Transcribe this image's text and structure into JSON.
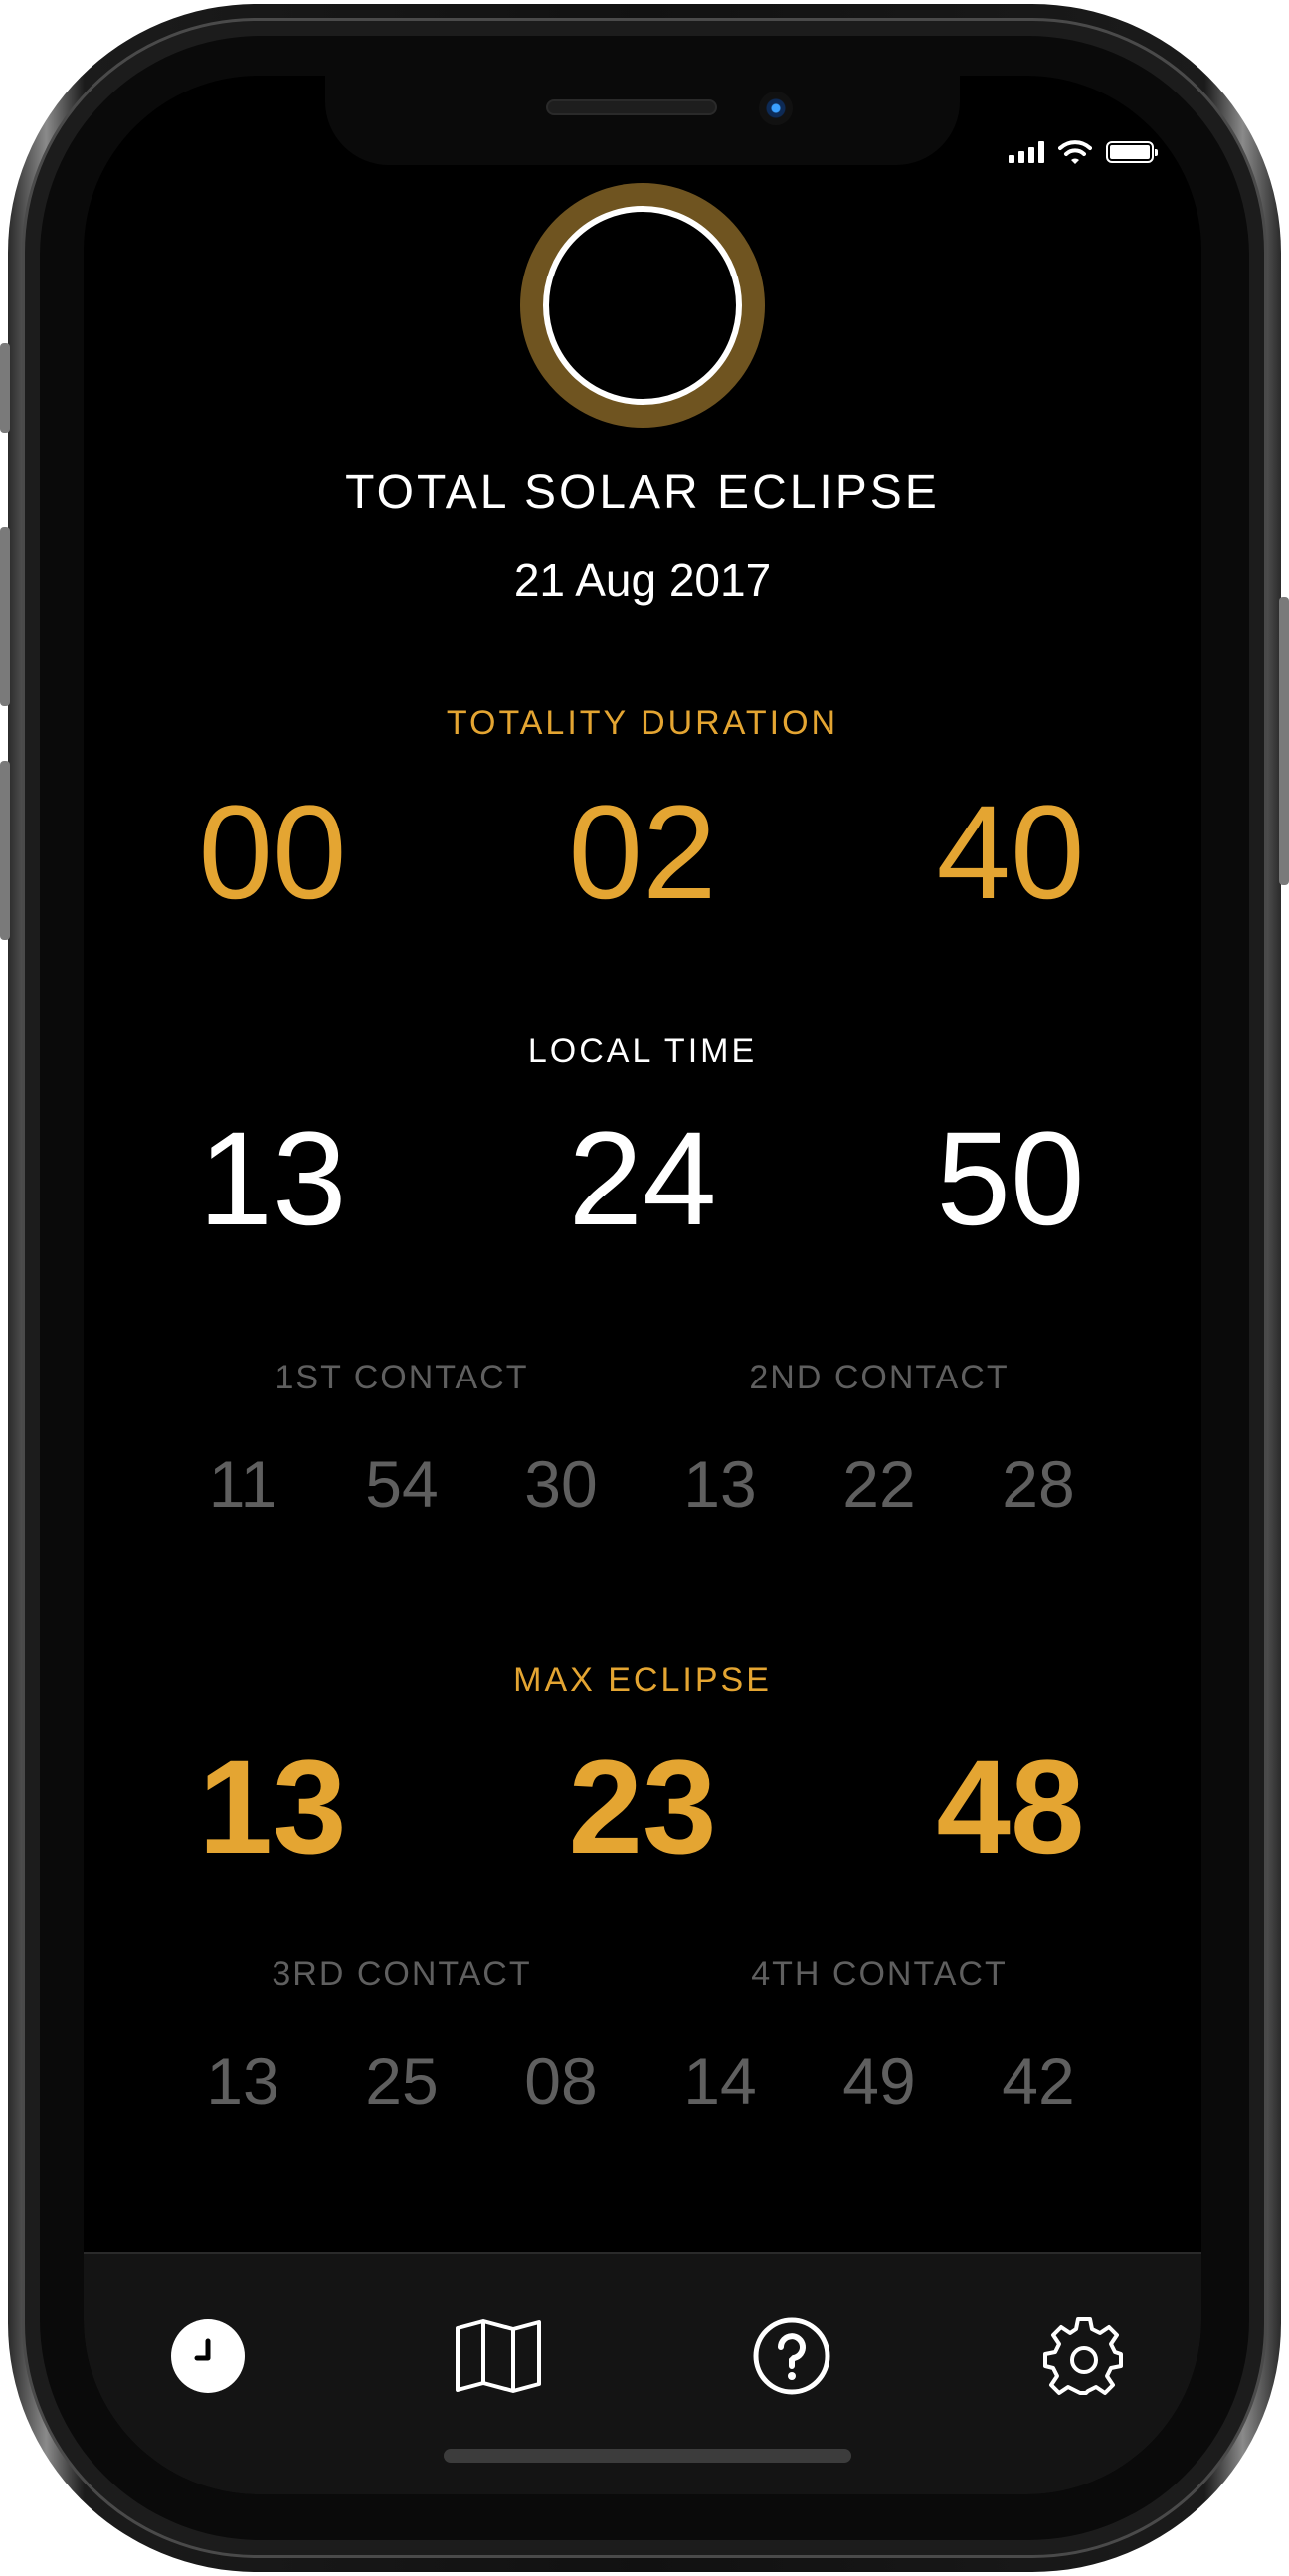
{
  "status_bar": {
    "signal": "signal-bars-icon",
    "wifi": "wifi-icon",
    "battery": "battery-icon"
  },
  "header": {
    "event_icon": "eclipse-icon",
    "title": "TOTAL SOLAR ECLIPSE",
    "date": "21 Aug 2017"
  },
  "totality": {
    "label": "TOTALITY DURATION",
    "values": [
      "00",
      "02",
      "40"
    ]
  },
  "local_time": {
    "label": "LOCAL TIME",
    "values": [
      "13",
      "24",
      "50"
    ]
  },
  "contacts_top": [
    {
      "label": "1ST CONTACT",
      "values": [
        "11",
        "54",
        "30"
      ]
    },
    {
      "label": "2ND CONTACT",
      "values": [
        "13",
        "22",
        "28"
      ]
    }
  ],
  "max_eclipse": {
    "label": "MAX ECLIPSE",
    "values": [
      "13",
      "23",
      "48"
    ]
  },
  "contacts_bottom": [
    {
      "label": "3RD CONTACT",
      "values": [
        "13",
        "25",
        "08"
      ]
    },
    {
      "label": "4TH CONTACT",
      "values": [
        "14",
        "49",
        "42"
      ]
    }
  ],
  "tabbar": {
    "tabs": [
      {
        "icon": "clock-icon",
        "active": true
      },
      {
        "icon": "map-icon",
        "active": false
      },
      {
        "icon": "help-icon",
        "active": false
      },
      {
        "icon": "gear-icon",
        "active": false
      }
    ]
  },
  "colors": {
    "accent": "#e4a532",
    "corona": "#6f5420",
    "background": "#000000",
    "muted": "#5f5f5f"
  }
}
